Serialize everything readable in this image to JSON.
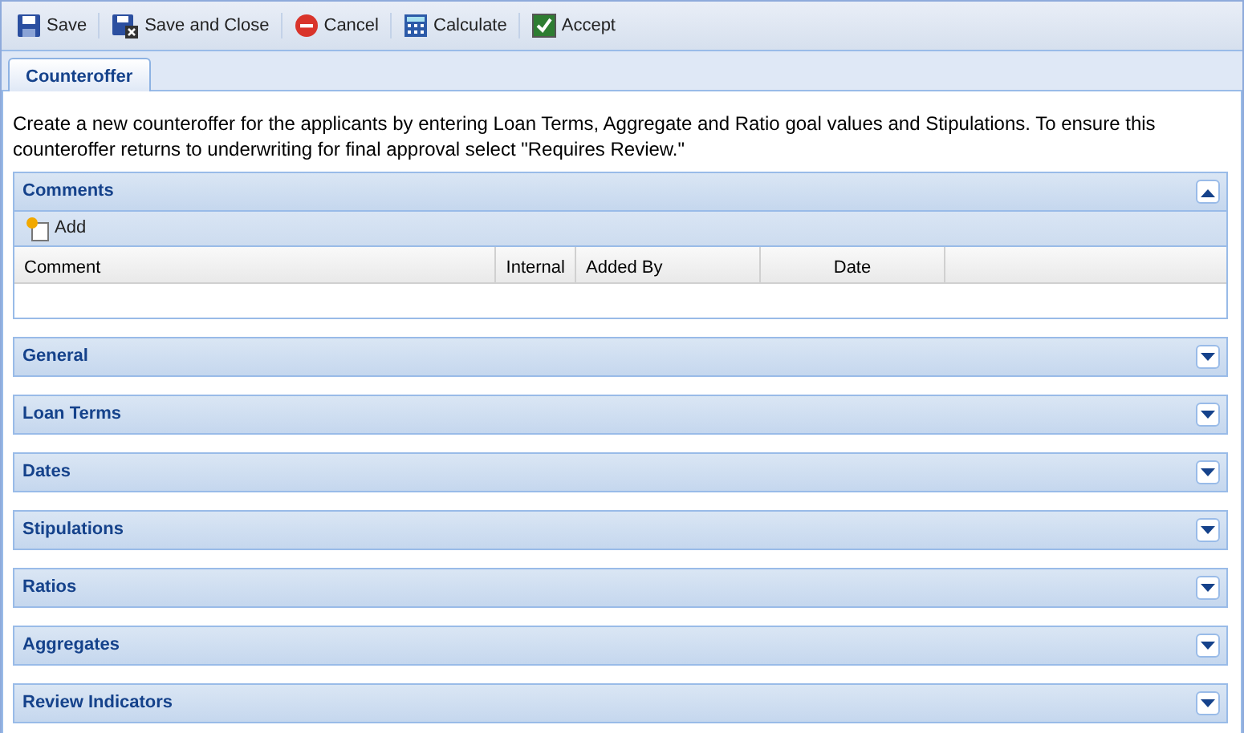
{
  "toolbar": [
    {
      "label": "Save",
      "kind": "save"
    },
    {
      "label": "Save and Close",
      "kind": "saveclose"
    },
    {
      "label": "Cancel",
      "kind": "cancel"
    },
    {
      "label": "Calculate",
      "kind": "calculate"
    },
    {
      "label": "Accept",
      "kind": "accept"
    }
  ],
  "tabs": [
    {
      "label": "Counteroffer",
      "selected": true
    }
  ],
  "description": "Create a new counteroffer for the applicants by entering Loan Terms, Aggregate and Ratio goal values and Stipulations. To ensure this counteroffer returns to underwriting for final approval select \"Requires Review.\"",
  "panels": [
    {
      "title": "Comments",
      "expanded": true,
      "add_label": "Add",
      "columns": [
        "Comment",
        "Internal",
        "Added By",
        "Date"
      ]
    },
    {
      "title": "General",
      "expanded": false
    },
    {
      "title": "Loan Terms",
      "expanded": false
    },
    {
      "title": "Dates",
      "expanded": false
    },
    {
      "title": "Stipulations",
      "expanded": false
    },
    {
      "title": "Ratios",
      "expanded": false
    },
    {
      "title": "Aggregates",
      "expanded": false
    },
    {
      "title": "Review Indicators",
      "expanded": false
    }
  ]
}
